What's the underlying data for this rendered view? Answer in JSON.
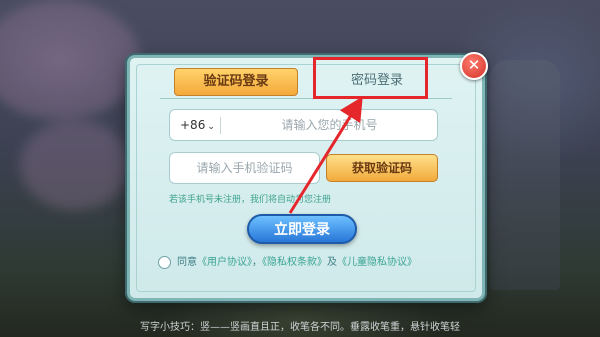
{
  "tabs": {
    "sms_label": "验证码登录",
    "password_label": "密码登录"
  },
  "phone": {
    "country_code": "+86",
    "placeholder": "请输入您的手机号"
  },
  "sms": {
    "placeholder": "请输入手机验证码",
    "get_code_label": "获取验证码"
  },
  "note": "若该手机号未注册，我们将自动为您注册",
  "login_button": "立即登录",
  "agreement": {
    "prefix": "同意",
    "user_agreement": "《用户协议》",
    "comma": "，",
    "privacy": "《隐私权条款》",
    "and": "及",
    "children_privacy": "《儿童隐私协议》"
  },
  "tip": "写字小技巧：竖——竖画直且正，收笔各不同。垂露收笔重，悬针收笔轻",
  "colors": {
    "highlight": "#e5262b",
    "accent_gold": "#f4a93b",
    "login_blue": "#2777d8"
  },
  "icons": {
    "close": "close-icon",
    "dropdown": "chevron-down-icon"
  }
}
